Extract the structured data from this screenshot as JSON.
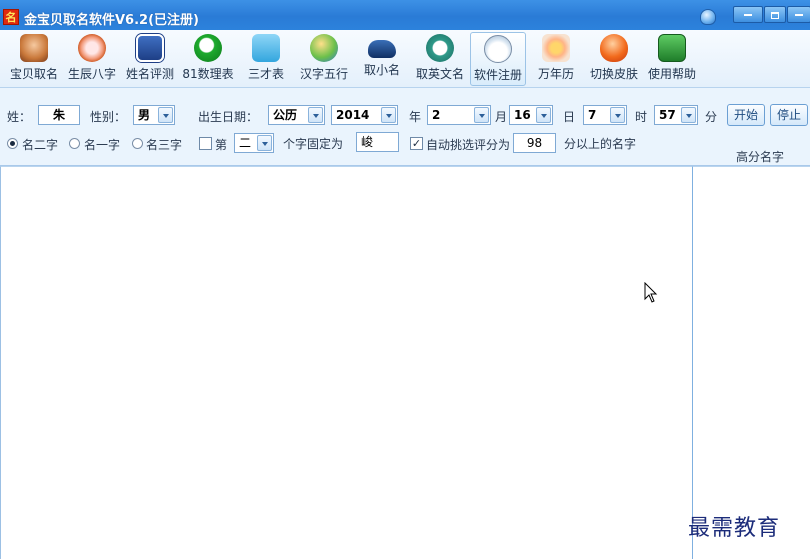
{
  "window": {
    "title": "金宝贝取名软件V6.2(已注册)",
    "logo_char": "名"
  },
  "toolbar": {
    "items": [
      {
        "label": "宝贝取名",
        "icon": "baby-icon"
      },
      {
        "label": "生辰八字",
        "icon": "magnifier-heart-icon"
      },
      {
        "label": "姓名评测",
        "icon": "chat-icon"
      },
      {
        "label": "81数理表",
        "icon": "green-bubble-icon"
      },
      {
        "label": "三才表",
        "icon": "bird-icon"
      },
      {
        "label": "汉字五行",
        "icon": "people-icon"
      },
      {
        "label": "取小名",
        "icon": "car-icon"
      },
      {
        "label": "取英文名",
        "icon": "stumbleupon-icon"
      },
      {
        "label": "软件注册",
        "icon": "reddit-icon"
      },
      {
        "label": "万年历",
        "icon": "flower-icon"
      },
      {
        "label": "切换皮肤",
        "icon": "heart-icon"
      },
      {
        "label": "使用帮助",
        "icon": "help-book-icon"
      }
    ]
  },
  "form": {
    "surname_label": "姓：",
    "surname_value": "朱",
    "gender_label": "性别：",
    "gender_value": "男",
    "birth_label": "出生日期：",
    "calendar_value": "公历",
    "year_value": "2014",
    "year_unit": "年",
    "month_value": "2",
    "month_unit": "月",
    "day_value": "16",
    "day_unit": "日",
    "hour_value": "7",
    "hour_unit": "时",
    "minute_value": "57",
    "minute_unit": "分",
    "start_label": "开始",
    "stop_label": "停止",
    "radio_two": "名二字",
    "radio_one": "名一字",
    "radio_three": "名三字",
    "fixed_prefix": "第",
    "fixed_pos_value": "二",
    "fixed_mid": "个字固定为",
    "fixed_char_value": "峻",
    "auto_label": "自动挑选评分为",
    "score_value": "98",
    "score_suffix": "分以上的名字",
    "high_names_header": "高分名字",
    "auto_checkmark": "✓"
  },
  "watermark": "最需教育"
}
